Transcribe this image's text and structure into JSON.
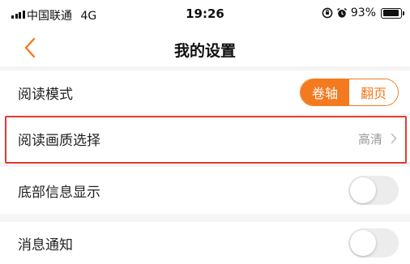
{
  "status_bar": {
    "carrier": "中国联通",
    "network": "4G",
    "time": "19:26",
    "battery_percent": "93%",
    "battery_level": 0.93,
    "icons": [
      "signal-icon",
      "orientation-lock-icon",
      "alarm-icon",
      "battery-icon"
    ]
  },
  "nav": {
    "title": "我的设置",
    "back_icon": "chevron-left-icon",
    "accent_color": "#f37a1f"
  },
  "settings": {
    "reading_mode": {
      "label": "阅读模式",
      "options": [
        "卷轴",
        "翻页"
      ],
      "selected": "卷轴"
    },
    "reading_quality": {
      "label": "阅读画质选择",
      "value": "高清",
      "highlight_color": "#e23a2e"
    },
    "bottom_info": {
      "label": "底部信息显示",
      "enabled": false
    },
    "notifications": {
      "label": "消息通知",
      "enabled": false
    }
  }
}
